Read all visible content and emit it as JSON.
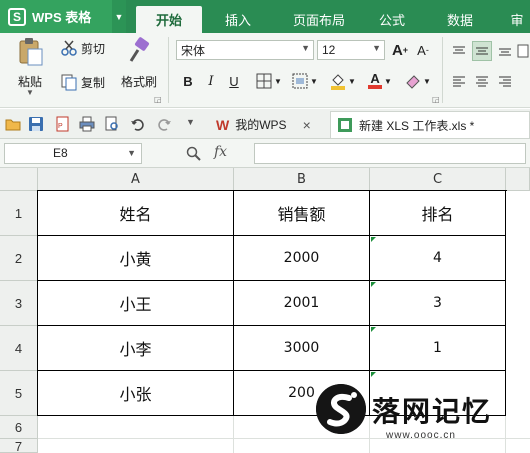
{
  "app": {
    "name": "WPS 表格"
  },
  "ribbon_tabs": [
    "开始",
    "插入",
    "页面布局",
    "公式",
    "数据",
    "审"
  ],
  "active_tab": "开始",
  "ribbon": {
    "paste_label": "粘贴",
    "cut_label": "剪切",
    "copy_label": "复制",
    "format_painter_label": "格式刷",
    "font_name": "宋体",
    "font_size": "12",
    "bold": "B",
    "italic": "I",
    "underline": "U",
    "grow_font": "A",
    "shrink_font": "A",
    "font_color_letter": "A"
  },
  "doc_tabs": [
    {
      "label": "我的WPS",
      "close": "×"
    },
    {
      "label": "新建 XLS 工作表.xls *"
    }
  ],
  "formula_bar": {
    "cell_ref": "E8",
    "fx": "fx",
    "formula": ""
  },
  "columns": [
    "A",
    "B",
    "C"
  ],
  "rows": [
    "1",
    "2",
    "3",
    "4",
    "5",
    "6",
    "7"
  ],
  "table": {
    "headers": [
      "姓名",
      "销售额",
      "排名"
    ],
    "rows": [
      [
        "小黄",
        "2000",
        "4"
      ],
      [
        "小王",
        "2001",
        "3"
      ],
      [
        "小李",
        "3000",
        "1"
      ],
      [
        "小张",
        "200",
        ""
      ]
    ]
  },
  "watermark": {
    "title": "落网记忆",
    "url": "www.oooc.cn"
  },
  "colors": {
    "title_bar": "#2a8c53",
    "accent_green": "#34a35f",
    "ribbon_bg": "#f3f6f3"
  }
}
